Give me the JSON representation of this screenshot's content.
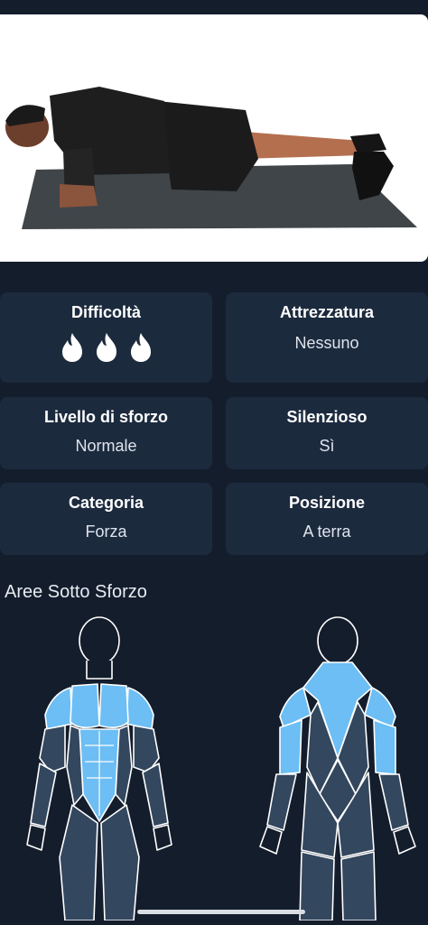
{
  "exercise_image": "plank-exercise-photo",
  "cards": [
    {
      "title": "Difficoltà",
      "value": "",
      "flames": 3
    },
    {
      "title": "Attrezzatura",
      "value": "Nessuno"
    },
    {
      "title": "Livello di sforzo",
      "value": "Normale"
    },
    {
      "title": "Silenzioso",
      "value": "Sì"
    },
    {
      "title": "Categoria",
      "value": "Forza"
    },
    {
      "title": "Posizione",
      "value": "A terra"
    }
  ],
  "muscles": {
    "title": "Aree Sotto Sforzo",
    "highlight_color": "#6cbef4",
    "front_highlighted": [
      "pectorals",
      "shoulders",
      "abdominals"
    ],
    "back_highlighted": [
      "trapezius",
      "shoulders",
      "triceps"
    ]
  },
  "colors": {
    "background": "#141d2c",
    "card": "#1c2a3e",
    "muscle_idle": "#33475e"
  }
}
